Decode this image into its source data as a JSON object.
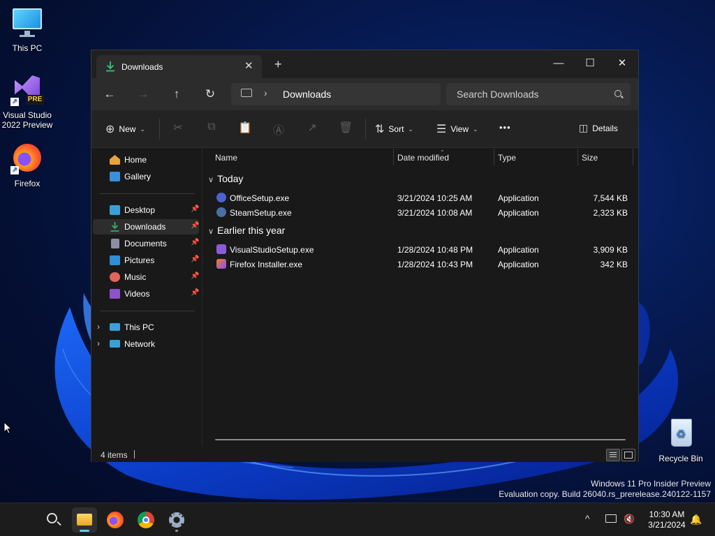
{
  "desktop": {
    "icons": [
      {
        "label": "This PC"
      },
      {
        "label": "Visual Studio 2022 Preview",
        "badge": "PRE"
      },
      {
        "label": "Firefox"
      },
      {
        "label": "Recycle Bin"
      }
    ]
  },
  "window": {
    "tab": {
      "label": "Downloads",
      "icon": "download-icon"
    },
    "new_tab_label": "+",
    "controls": {
      "minimize": "—",
      "maximize": "☐",
      "close": "✕"
    },
    "nav": {
      "back": "←",
      "forward": "→",
      "up": "↑",
      "refresh": "↻"
    },
    "address": {
      "separator": "›",
      "crumb": "Downloads"
    },
    "search": {
      "placeholder": "Search Downloads"
    },
    "commands": {
      "new": "New",
      "sort": "Sort",
      "view": "View",
      "more": "•••",
      "details": "Details"
    },
    "sidebar": {
      "items": [
        {
          "label": "Home",
          "color": "#e8a33d"
        },
        {
          "label": "Gallery",
          "color": "#3b8fd9"
        },
        {
          "label": "Desktop",
          "color": "#3a9fd8",
          "pinned": true
        },
        {
          "label": "Downloads",
          "color": "#31b267",
          "pinned": true,
          "selected": true
        },
        {
          "label": "Documents",
          "color": "#8a8fa6",
          "pinned": true
        },
        {
          "label": "Pictures",
          "color": "#2f8ed6",
          "pinned": true
        },
        {
          "label": "Music",
          "color": "#e2655b",
          "pinned": true
        },
        {
          "label": "Videos",
          "color": "#8e52c9",
          "pinned": true
        },
        {
          "label": "This PC",
          "color": "#3aa0d8"
        },
        {
          "label": "Network",
          "color": "#3aa0d8"
        }
      ]
    },
    "columns": [
      "Name",
      "Date modified",
      "Type",
      "Size"
    ],
    "groups": [
      {
        "label": "Today",
        "files": [
          {
            "name": "OfficeSetup.exe",
            "date": "3/21/2024 10:25 AM",
            "type": "Application",
            "size": "7,544 KB",
            "color": "#4b63d1"
          },
          {
            "name": "SteamSetup.exe",
            "date": "3/21/2024 10:08 AM",
            "type": "Application",
            "size": "2,323 KB",
            "color": "#4a6fa5"
          }
        ]
      },
      {
        "label": "Earlier this year",
        "files": [
          {
            "name": "VisualStudioSetup.exe",
            "date": "1/28/2024 10:48 PM",
            "type": "Application",
            "size": "3,909 KB",
            "color": "#8b5cd6"
          },
          {
            "name": "Firefox Installer.exe",
            "date": "1/28/2024 10:43 PM",
            "type": "Application",
            "size": "342 KB",
            "color": "#f07a2a"
          }
        ]
      }
    ],
    "status": {
      "count": "4 items"
    }
  },
  "watermark": {
    "line1": "Windows 11 Pro Insider Preview",
    "line2": "Evaluation copy. Build 26040.rs_prerelease.240122-1157"
  },
  "taskbar": {
    "clock_time": "10:30 AM",
    "clock_date": "3/21/2024",
    "tray_chevron": "^"
  }
}
